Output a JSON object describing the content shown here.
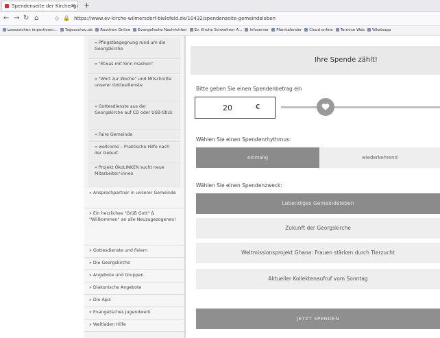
{
  "browser": {
    "tab_title": "Spendenseite der Kirchengem",
    "new_tab": "+",
    "url": "https://www.ev-kirche-wilmersdorf-bielefeld.de/10432/spendenseite-gemeindeleben",
    "bookmarks": [
      "Lesezeichen importieren...",
      "Tagesschau.de",
      "Routinen Online",
      "Evangelische Nachrichten",
      "Ev. Kirche Schwelmer A...",
      "Infoserver",
      "Pfarrkalender",
      "Cloud online",
      "Termine Web",
      "Whatsapp"
    ]
  },
  "sidebar": {
    "sub_items": [
      "» Pfingstbegegnung rund um die Georgskirche",
      "» \"Etwas mit Sinn machen\"",
      "» \"Wort zur Woche\" und Mitschnitte unserer Gottesdienste",
      "» Gottesdienste aus der Georgskirche auf CD oder USB-Stick",
      "» Faire Gemeinde",
      "» wellcome – Praktische Hilfe nach der Geburt",
      "» Projekt ÖkoLINKEN sucht neue Mitarbeiter/-innen"
    ],
    "top_items": [
      "» Ansprechpartner in unserer Gemeinde",
      "» Ein herzliches \"Grüß Gott\" & \"Willkommen\" an alle Neuzugezogenen!",
      "» Gottesdienste und Feiern",
      "» Die Georgskirche",
      "» Angebote und Gruppen",
      "» Diakonische Angebote",
      "» Die Apis",
      "» Evangelisches Jugendwerk",
      "» Weltladen Hilfe"
    ]
  },
  "donation": {
    "banner": "Ihre Spende zählt!",
    "amount_label": "Bitte geben Sie einen Spendenbetrag ein",
    "amount": "20",
    "currency": "€",
    "slider_level_fraction": 0.28,
    "rhythm_label": "Wählen Sie einen Spendenrhythmus:",
    "rhythm_options": [
      "einmalig",
      "wiederkehrend"
    ],
    "purpose_label": "Wählen Sie einen Spendenzweck:",
    "purposes": [
      "Lebendiges Gemeindeleben",
      "Zukunft der Georgskirche",
      "Weltmissionsprojekt Ghana: Frauen stärken durch Tierzucht",
      "Aktueller Kollektenaufruf vom Sonntag"
    ],
    "submit": "JETZT SPENDEN"
  }
}
